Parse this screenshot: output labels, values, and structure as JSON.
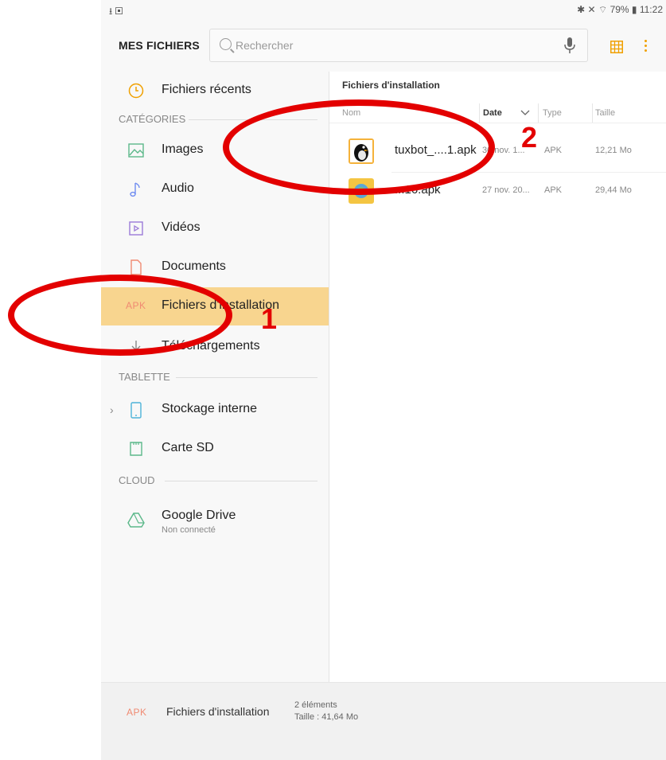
{
  "status_bar": {
    "left_icons": "⭳ ▣",
    "right_text": "✱ ✕ ⌔ 79% ▮ 11:22"
  },
  "header": {
    "app_title": "MES FICHIERS",
    "search_placeholder": "Rechercher"
  },
  "sidebar": {
    "recent": "Fichiers récents",
    "sections": {
      "categories": "CATÉGORIES",
      "tablet": "TABLETTE",
      "cloud": "CLOUD"
    },
    "items": [
      {
        "label": "Images"
      },
      {
        "label": "Audio"
      },
      {
        "label": "Vidéos"
      },
      {
        "label": "Documents"
      },
      {
        "label": "Fichiers d'installation",
        "tag": "APK"
      },
      {
        "label": "Téléchargements"
      }
    ],
    "tablet_items": [
      {
        "label": "Stockage interne"
      },
      {
        "label": "Carte SD"
      }
    ],
    "cloud_items": [
      {
        "label": "Google Drive",
        "sub": "Non connecté"
      }
    ]
  },
  "content": {
    "title": "Fichiers d'installation",
    "columns": {
      "name": "Nom",
      "date": "Date",
      "type": "Type",
      "size": "Taille"
    },
    "files": [
      {
        "name": "tuxbot_....1.apk",
        "date": "30 nov. 1...",
        "type": "APK",
        "size": "12,21 Mo"
      },
      {
        "name": "...16.apk",
        "date": "27 nov. 20...",
        "type": "APK",
        "size": "29,44 Mo"
      }
    ]
  },
  "footer": {
    "tag": "APK",
    "label": "Fichiers d'installation",
    "count": "2 éléments",
    "size": "Taille : 41,64 Mo"
  },
  "annotations": {
    "label_1": "1",
    "label_2": "2"
  },
  "colors": {
    "accent": "#f0a000",
    "active_bg": "#f8d58f",
    "apk_tag": "#f08a72",
    "annotation": "#e30000"
  }
}
